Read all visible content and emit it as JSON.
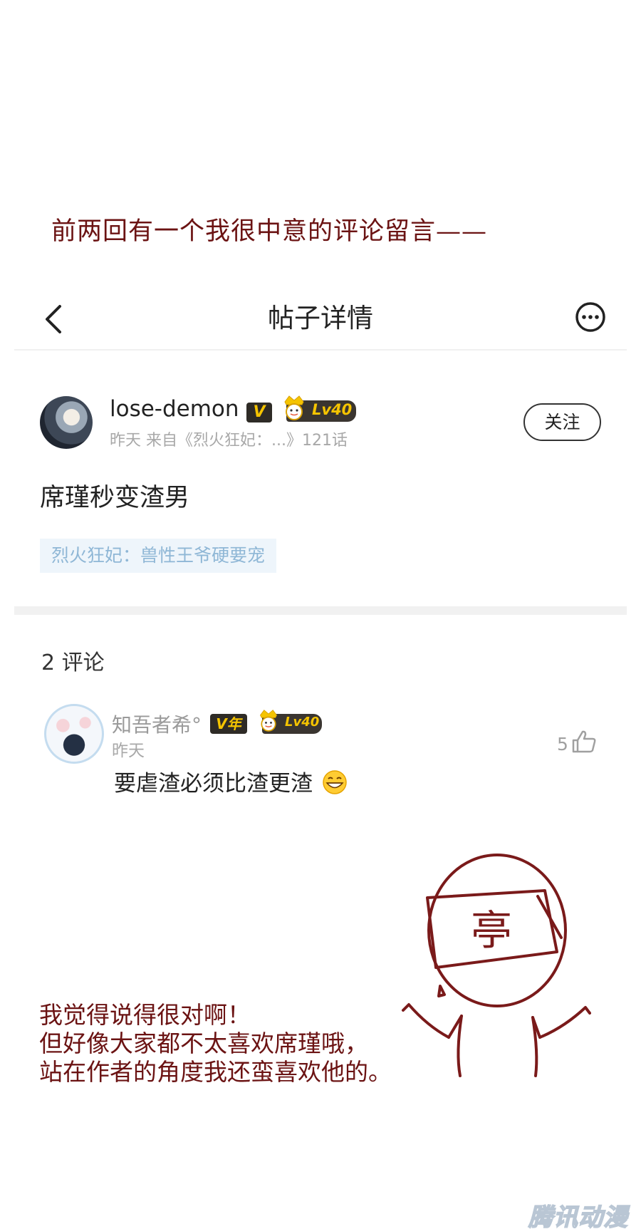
{
  "intro_caption": "前两回有一个我很中意的评论留言——",
  "navbar": {
    "title": "帖子详情",
    "back_icon": "chevron-left-icon",
    "more_icon": "more-circle-icon"
  },
  "post": {
    "username": "lose-demon",
    "vip_badge": "V",
    "level_badge": "Lv40",
    "meta": "昨天  来自《烈火狂妃：...》121话",
    "follow_label": "关注",
    "title": "席瑾秒变渣男",
    "topic_tag": "烈火狂妃：兽性王爷硬要宠"
  },
  "comments_section": {
    "count_label": "2 评论",
    "items": [
      {
        "username": "知吾者希°",
        "vip_badge": "V年",
        "level_badge": "Lv40",
        "time": "昨天",
        "like_count": "5",
        "text": "要虐渣必须比渣更渣",
        "emoji": "grinning-face-icon"
      }
    ]
  },
  "handwritten_note": {
    "lines": [
      "我觉得说得很对啊！",
      "但好像大家都不太喜欢席瑾哦，",
      "站在作者的角度我还蛮喜欢他的。"
    ]
  },
  "doodle_sign": "亭",
  "watermark": "腾讯动漫",
  "colors": {
    "handwriting": "#6b1313",
    "tag_bg": "#eef5fb",
    "tag_text": "#8fb7d6",
    "badge_gold": "#f5c400",
    "badge_dark": "#2e2b26"
  }
}
